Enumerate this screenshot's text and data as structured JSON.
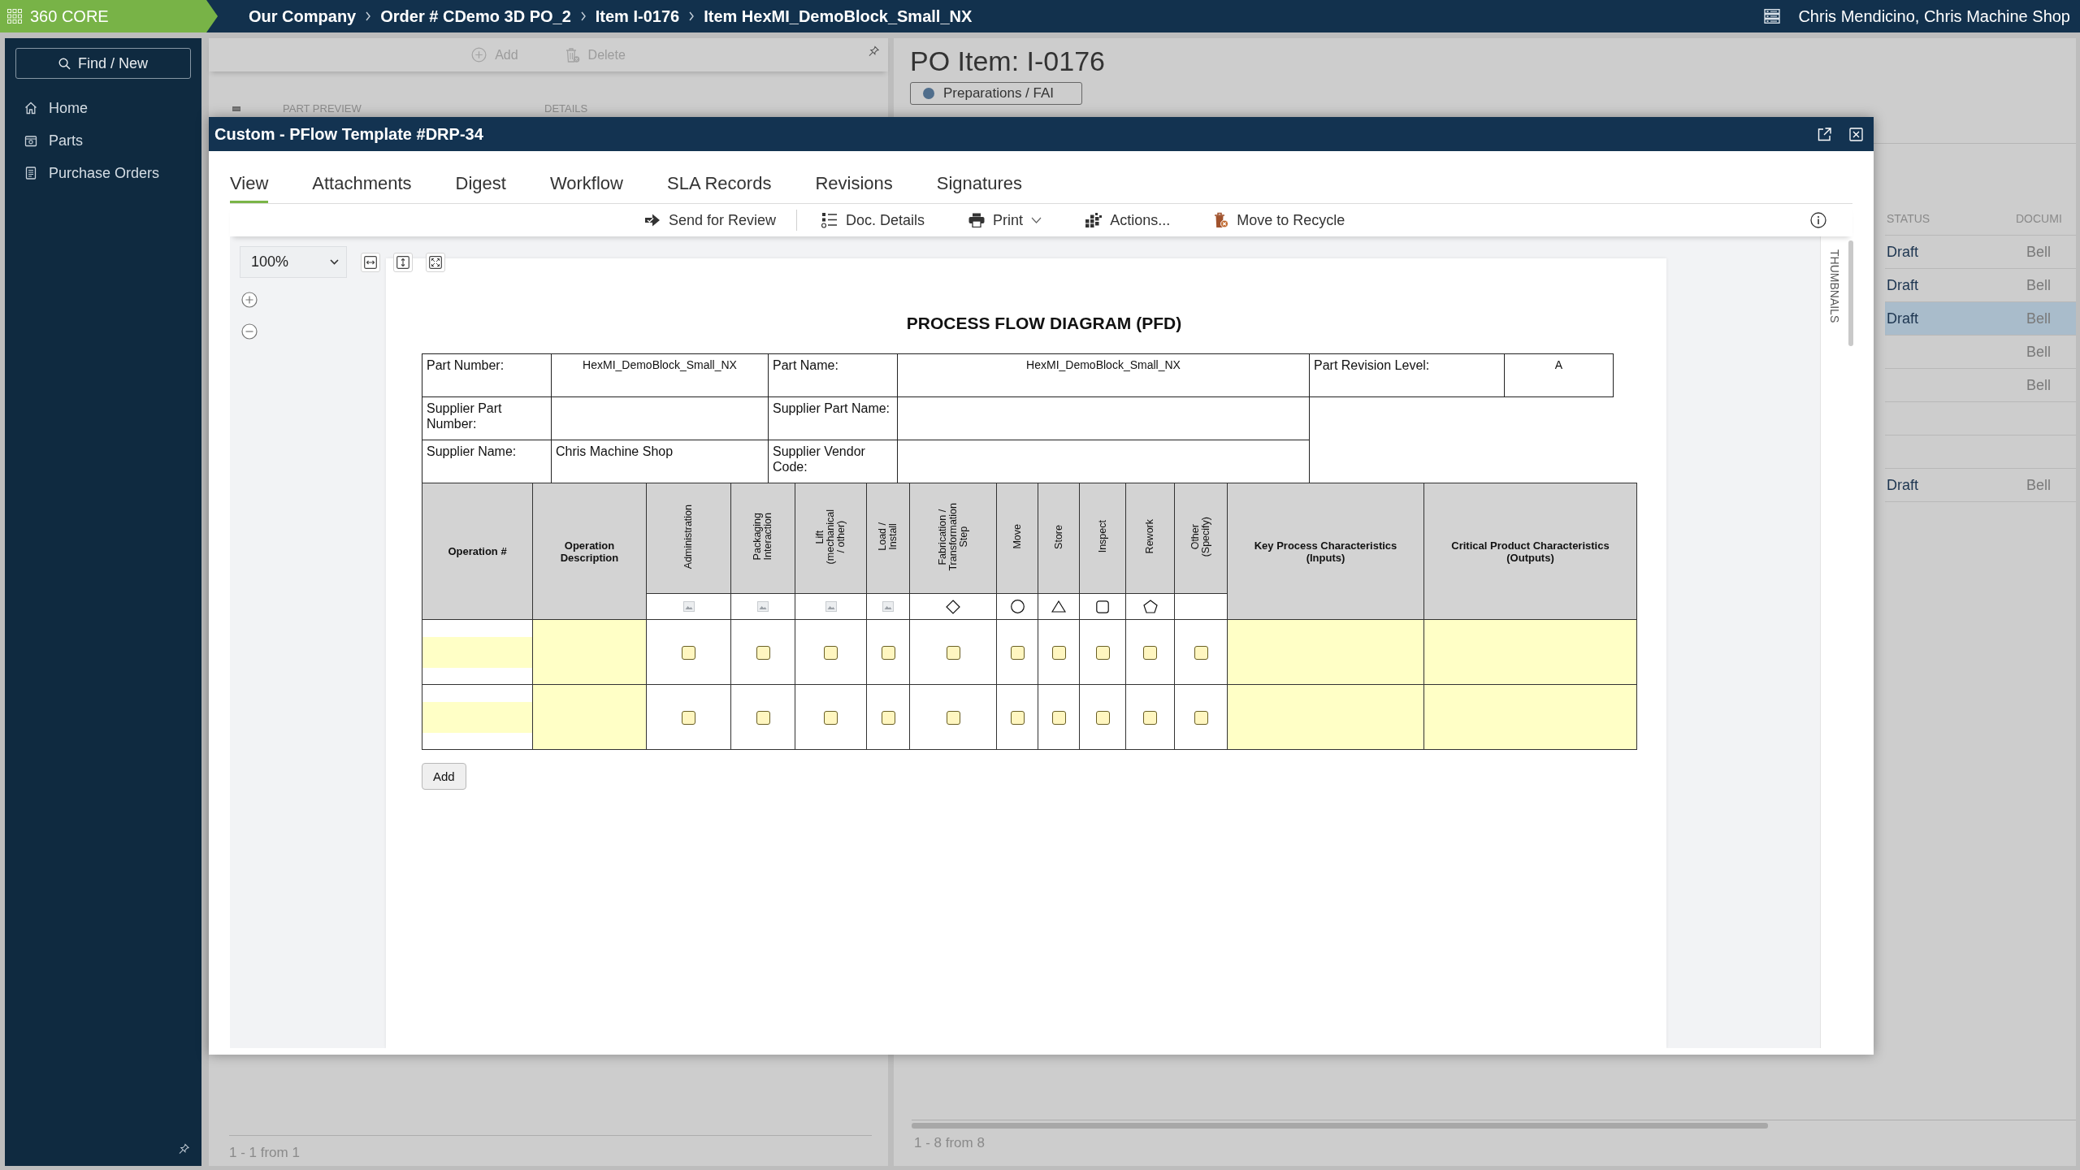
{
  "topbar": {
    "app_name": "360 CORE",
    "breadcrumbs": [
      "Our Company",
      "Order # CDemo 3D PO_2",
      "Item I-0176",
      "Item HexMI_DemoBlock_Small_NX"
    ],
    "user": "Chris Mendicino, Chris Machine Shop"
  },
  "sidebar": {
    "find_button": "Find / New",
    "items": [
      "Home",
      "Parts",
      "Purchase Orders"
    ]
  },
  "left_panel": {
    "toolbar": [
      "Add",
      "Delete"
    ],
    "columns": [
      "PART PREVIEW",
      "DETAILS"
    ],
    "footer": "1 - 1 from 1"
  },
  "right_panel": {
    "title": "PO Item: I-0176",
    "status_badge": "Preparations / FAI",
    "table": {
      "columns": [
        "STATUS",
        "DOCUMI"
      ],
      "rows": [
        {
          "status": "Draft",
          "document": "Bell",
          "selected": false
        },
        {
          "status": "Draft",
          "document": "Bell",
          "selected": false
        },
        {
          "status": "Draft",
          "document": "Bell",
          "selected": true
        },
        {
          "document": "Bell",
          "selected": false
        },
        {
          "document": "Bell",
          "selected": false
        },
        {
          "selected": false
        },
        {
          "selected": false
        },
        {
          "status": "Draft",
          "document": "Bell",
          "selected": false
        }
      ]
    },
    "footer": "1 - 8 from 8"
  },
  "dialog": {
    "title": "Custom - PFlow Template #DRP-34",
    "tabs": [
      {
        "label": "View",
        "selected": true
      },
      {
        "label": "Attachments",
        "selected": false
      },
      {
        "label": "Digest",
        "selected": false
      },
      {
        "label": "Workflow",
        "selected": false
      },
      {
        "label": "SLA Records",
        "selected": false
      },
      {
        "label": "Revisions",
        "selected": false
      },
      {
        "label": "Signatures",
        "selected": false
      }
    ],
    "toolbar": [
      {
        "label": "Send for Review",
        "has_menu": false
      },
      {
        "label": "Doc. Details",
        "has_menu": false
      },
      {
        "label": "Print",
        "has_menu": true
      },
      {
        "label": "Actions...",
        "has_menu": false
      },
      {
        "label": "Move to Recycle",
        "has_menu": false
      }
    ],
    "viewer": {
      "zoom": "100%",
      "side_tab": "THUMBNAILS"
    },
    "document": {
      "title": "PROCESS FLOW DIAGRAM (PFD)",
      "header_rows": [
        [
          {
            "label": "Part Number:",
            "value": "HexMI_DemoBlock_Small_NX"
          },
          {
            "label": "Part Name:",
            "value": "HexMI_DemoBlock_Small_NX"
          },
          {
            "label": "Part Revision Level:",
            "value": "A"
          }
        ],
        [
          {
            "label": "Supplier Part Number:"
          },
          {
            "label": "Supplier Part Name:"
          }
        ],
        [
          {
            "label": "Supplier Name:",
            "value": "Chris Machine Shop"
          },
          {
            "label": "Supplier Vendor Code:"
          }
        ]
      ],
      "table": {
        "columns": [
          {
            "label": "Operation #",
            "kind": "id"
          },
          {
            "label": "Operation Description",
            "kind": "text"
          },
          {
            "label": "Administration",
            "kind": "step"
          },
          {
            "label": "Packaging\nInteraction",
            "kind": "step"
          },
          {
            "label": "Lift\n(mechanical\n/ other)",
            "kind": "step"
          },
          {
            "label": "Load /\nInstall",
            "kind": "step"
          },
          {
            "label": "Fabrication /\nTransformation\nStep",
            "kind": "step"
          },
          {
            "label": "Move",
            "kind": "step"
          },
          {
            "label": "Store",
            "kind": "step"
          },
          {
            "label": "Inspect",
            "kind": "step"
          },
          {
            "label": "Rework",
            "kind": "step"
          },
          {
            "label": "Other\n(Specify)",
            "kind": "step"
          },
          {
            "label": "Key Process Characteristics (Inputs)",
            "kind": "text"
          },
          {
            "label": "Critical Product Characteristics (Outputs)",
            "kind": "text"
          }
        ],
        "rows": [
          {
            "checked": [
              false,
              false,
              false,
              false,
              false,
              false,
              false,
              false,
              false,
              false
            ]
          },
          {
            "checked": [
              false,
              false,
              false,
              false,
              false,
              false,
              false,
              false,
              false,
              false
            ]
          }
        ]
      },
      "add_button": "Add"
    }
  }
}
